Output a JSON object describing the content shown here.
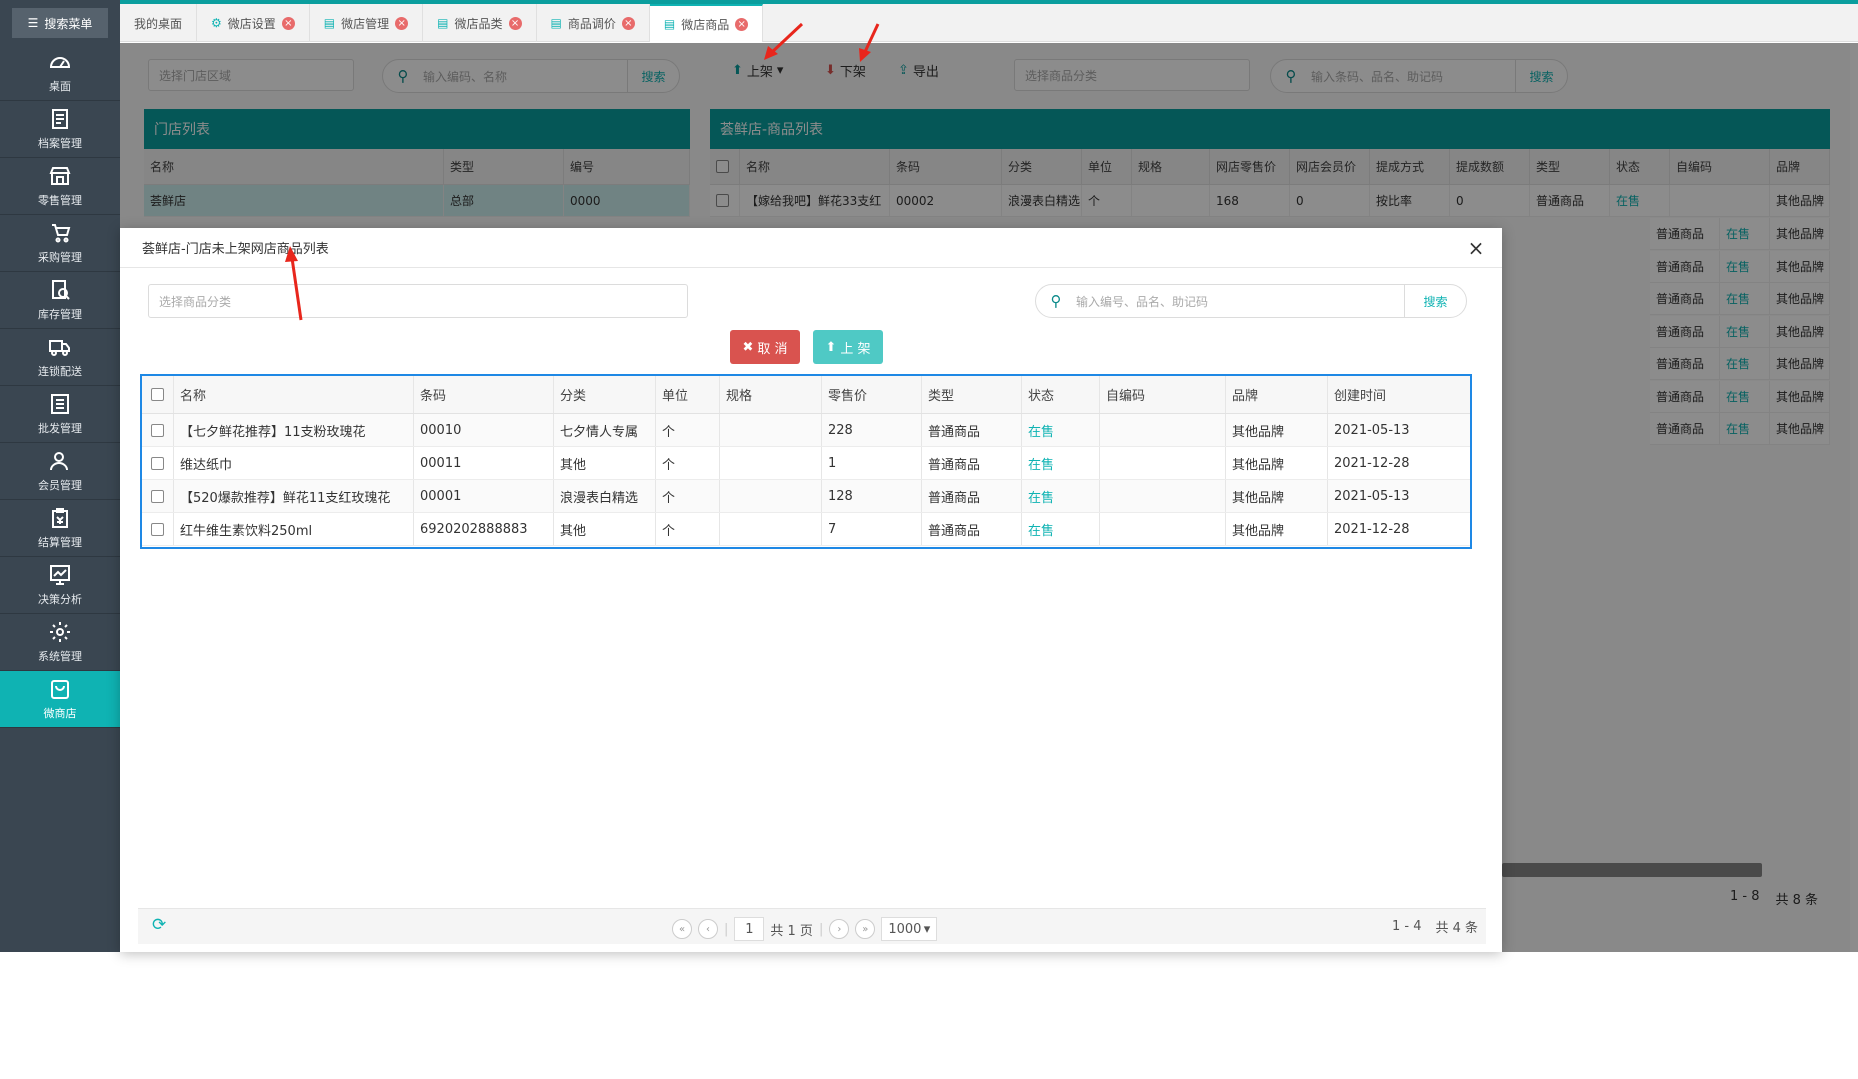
{
  "sidebar": {
    "search_label": "搜索菜单",
    "items": [
      {
        "label": "桌面",
        "icon": "dashboard-icon"
      },
      {
        "label": "档案管理",
        "icon": "archive-icon"
      },
      {
        "label": "零售管理",
        "icon": "store-icon"
      },
      {
        "label": "采购管理",
        "icon": "purchase-icon"
      },
      {
        "label": "库存管理",
        "icon": "inventory-icon"
      },
      {
        "label": "连锁配送",
        "icon": "truck-icon"
      },
      {
        "label": "批发管理",
        "icon": "wholesale-icon"
      },
      {
        "label": "会员管理",
        "icon": "member-icon"
      },
      {
        "label": "结算管理",
        "icon": "settlement-icon"
      },
      {
        "label": "决策分析",
        "icon": "analysis-icon"
      },
      {
        "label": "系统管理",
        "icon": "gear-icon"
      },
      {
        "label": "微商店",
        "icon": "shop-bag-icon"
      }
    ]
  },
  "tabs": [
    {
      "label": "我的桌面"
    },
    {
      "label": "微店设置"
    },
    {
      "label": "微店管理"
    },
    {
      "label": "微店品类"
    },
    {
      "label": "商品调价"
    },
    {
      "label": "微店商品"
    }
  ],
  "left_panel": {
    "area_placeholder": "选择门店区域",
    "search_placeholder": "输入编码、名称",
    "search_button": "搜索",
    "title": "门店列表",
    "columns": [
      "名称",
      "类型",
      "编号"
    ],
    "row": [
      "荟鲜店",
      "总部",
      "0000"
    ]
  },
  "right_panel": {
    "btn_on": "上架",
    "btn_off": "下架",
    "btn_export": "导出",
    "category_placeholder": "选择商品分类",
    "search_placeholder": "输入条码、品名、助记码",
    "search_button": "搜索",
    "title": "荟鲜店-商品列表",
    "columns": [
      "名称",
      "条码",
      "分类",
      "单位",
      "规格",
      "网店零售价",
      "网店会员价",
      "提成方式",
      "提成数额",
      "类型",
      "状态",
      "自编码",
      "品牌"
    ],
    "first_row": [
      "【嫁给我吧】鲜花33支红",
      "00002",
      "浪漫表白精选",
      "个",
      "",
      "168",
      "0",
      "按比率",
      "0",
      "普通商品",
      "在售",
      "",
      "其他品牌"
    ],
    "extra_type": "普通商品",
    "extra_status": "在售",
    "extra_brand": "其他品牌",
    "range_text": "1 - 8",
    "total_text": "共 8 条"
  },
  "modal": {
    "title": "荟鲜店-门店未上架网店商品列表",
    "category_placeholder": "选择商品分类",
    "search_placeholder": "输入编号、品名、助记码",
    "search_button": "搜索",
    "cancel_button": "取 消",
    "up_button": "上 架",
    "columns": [
      "名称",
      "条码",
      "分类",
      "单位",
      "规格",
      "零售价",
      "类型",
      "状态",
      "自编码",
      "品牌",
      "创建时间"
    ],
    "rows": [
      [
        "【七夕鲜花推荐】11支粉玫瑰花",
        "00010",
        "七夕情人专属",
        "个",
        "",
        "228",
        "普通商品",
        "在售",
        "",
        "其他品牌",
        "2021-05-13"
      ],
      [
        "维达纸巾",
        "00011",
        "其他",
        "个",
        "",
        "1",
        "普通商品",
        "在售",
        "",
        "其他品牌",
        "2021-12-28"
      ],
      [
        "【520爆款推荐】鲜花11支红玫瑰花",
        "00001",
        "浪漫表白精选",
        "个",
        "",
        "128",
        "普通商品",
        "在售",
        "",
        "其他品牌",
        "2021-05-13"
      ],
      [
        "红牛维生素饮料250ml",
        "6920202888883",
        "其他",
        "个",
        "",
        "7",
        "普通商品",
        "在售",
        "",
        "其他品牌",
        "2021-12-28"
      ]
    ],
    "pager": {
      "page": "1",
      "total_pages": "共 1 页",
      "page_size": "1000",
      "range": "1 - 4",
      "total": "共 4 条"
    }
  },
  "colors": {
    "accent": "#0a9e9e",
    "active_nav": "#0fb3b3",
    "cancel": "#d9534f",
    "table_border": "#1e88e5",
    "arrow": "#e8261c"
  }
}
